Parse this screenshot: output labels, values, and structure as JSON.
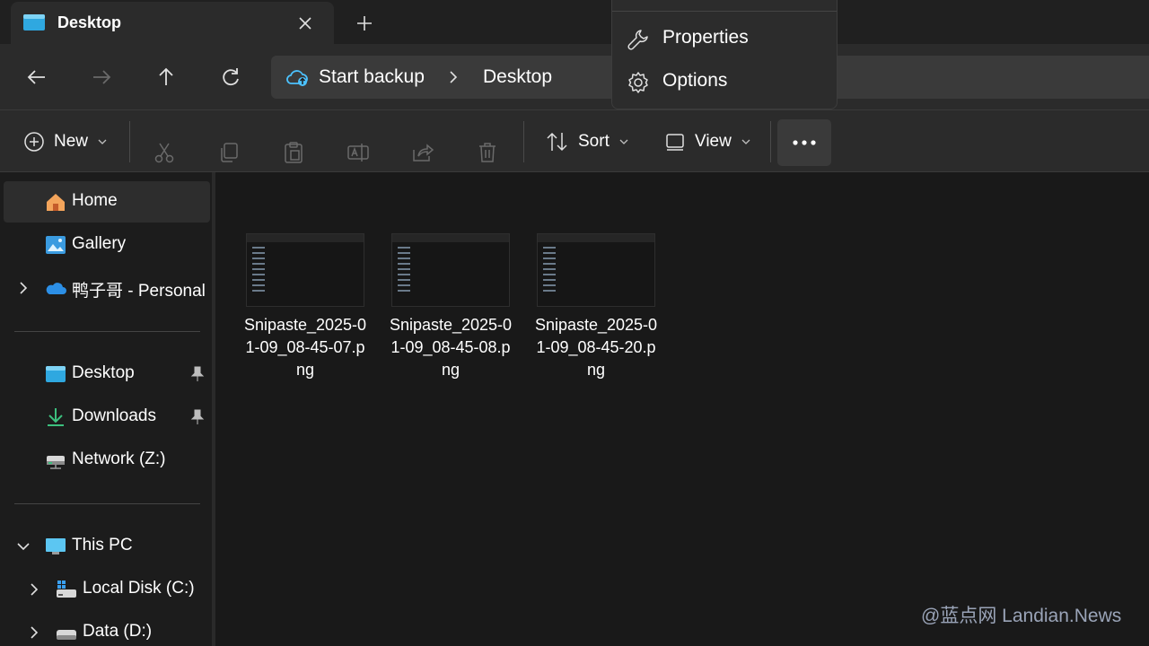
{
  "window": {
    "tab_title": "Desktop"
  },
  "address": {
    "segments": [
      "Start backup",
      "Desktop"
    ]
  },
  "commandbar": {
    "new_label": "New",
    "sort_label": "Sort",
    "view_label": "View"
  },
  "menu": {
    "items": [
      {
        "label": "Properties",
        "icon": "wrench-icon"
      },
      {
        "label": "Options",
        "icon": "gear-icon"
      }
    ]
  },
  "sidebar": {
    "items": [
      {
        "label": "Home",
        "icon": "home-icon",
        "selected": true
      },
      {
        "label": "Gallery",
        "icon": "gallery-icon"
      },
      {
        "label": "鸭子哥 - Personal",
        "icon": "onedrive-icon"
      },
      {
        "label": "Desktop",
        "icon": "desktop-folder-icon",
        "pinned": true
      },
      {
        "label": "Downloads",
        "icon": "download-icon",
        "pinned": true
      },
      {
        "label": "Network (Z:)",
        "icon": "network-drive-icon"
      },
      {
        "label": "This PC",
        "icon": "pc-icon"
      },
      {
        "label": "Local Disk (C:)",
        "icon": "windows-drive-icon"
      },
      {
        "label": "Data (D:)",
        "icon": "drive-icon"
      }
    ]
  },
  "files": [
    {
      "name": "Snipaste_2025-01-09_08-45-07.png"
    },
    {
      "name": "Snipaste_2025-01-09_08-45-08.png"
    },
    {
      "name": "Snipaste_2025-01-09_08-45-20.png"
    }
  ],
  "watermark": "@蓝点网 Landian.News"
}
